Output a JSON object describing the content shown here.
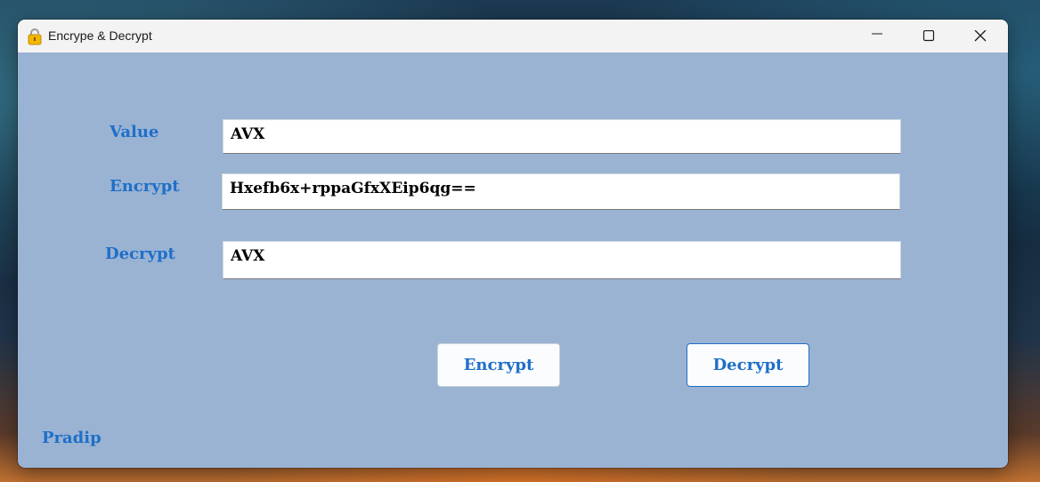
{
  "window": {
    "title": "Encrype & Decrypt",
    "icon": "lock-icon",
    "controls": [
      "minimize-icon",
      "maximize-icon",
      "close-icon"
    ]
  },
  "form": {
    "value_label": "Value",
    "value_text": "AVX",
    "encrypt_label": "Encrypt",
    "encrypt_text": "Hxefb6x+rppaGfxXEip6qg==",
    "decrypt_label": "Decrypt",
    "decrypt_text": "AVX"
  },
  "buttons": {
    "encrypt_label": "Encrypt",
    "decrypt_label": "Decrypt"
  },
  "footer": {
    "author": "Pradip"
  },
  "colors": {
    "window_bg": "#9ab3d3",
    "accent": "#1f6fc8",
    "titlebar": "#f3f3f3"
  }
}
